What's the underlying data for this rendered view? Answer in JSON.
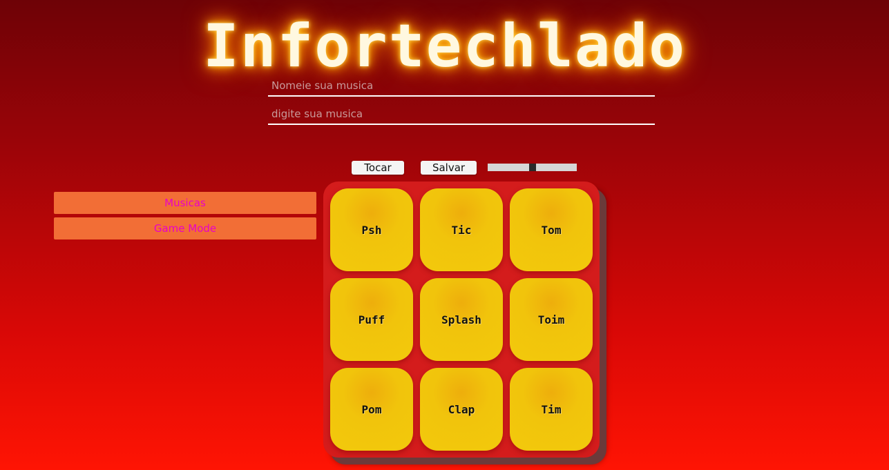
{
  "header": {
    "title": "Infortechlado"
  },
  "form": {
    "name_placeholder": "Nomeie sua musica",
    "name_value": "",
    "song_placeholder": "digite sua musica",
    "song_value": ""
  },
  "controls": {
    "play_label": "Tocar",
    "save_label": "Salvar",
    "slider_value": 0.5
  },
  "sidebar": {
    "items": [
      {
        "label": "Musicas"
      },
      {
        "label": "Game Mode"
      }
    ]
  },
  "pads": [
    {
      "label": "Psh"
    },
    {
      "label": "Tic"
    },
    {
      "label": "Tom"
    },
    {
      "label": "Puff"
    },
    {
      "label": "Splash"
    },
    {
      "label": "Toim"
    },
    {
      "label": "Pom"
    },
    {
      "label": "Clap"
    },
    {
      "label": "Tim"
    }
  ],
  "colors": {
    "background_top": "#6e0206",
    "background_bottom": "#ff1404",
    "title_glow": "#ffb000",
    "pad_yellow": "#f2c90c",
    "board_red": "#d41c1c",
    "sidebar_button": "#f26e36",
    "sidebar_text": "#e800c8"
  }
}
